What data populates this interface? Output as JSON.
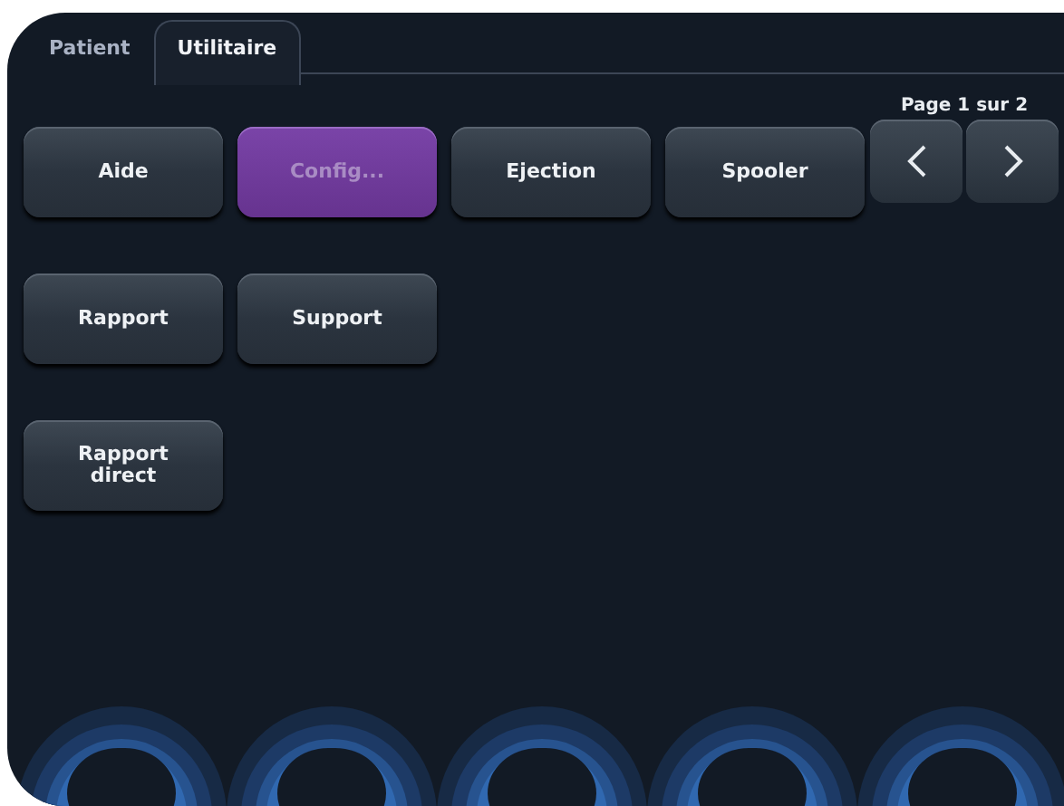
{
  "tabs": [
    {
      "label": "Patient",
      "selected": false
    },
    {
      "label": "Utilitaire",
      "selected": true
    }
  ],
  "pager": {
    "label": "Page 1 sur 2"
  },
  "button_rows": [
    [
      {
        "label": "Aide",
        "selected": false
      },
      {
        "label": "Config...",
        "selected": true
      },
      {
        "label": "Ejection",
        "selected": false
      },
      {
        "label": "Spooler",
        "selected": false
      }
    ],
    [
      {
        "label": "Rapport",
        "selected": false
      },
      {
        "label": "Support",
        "selected": false
      }
    ],
    [
      {
        "label": "Rapport\ndirect",
        "selected": false
      }
    ]
  ]
}
